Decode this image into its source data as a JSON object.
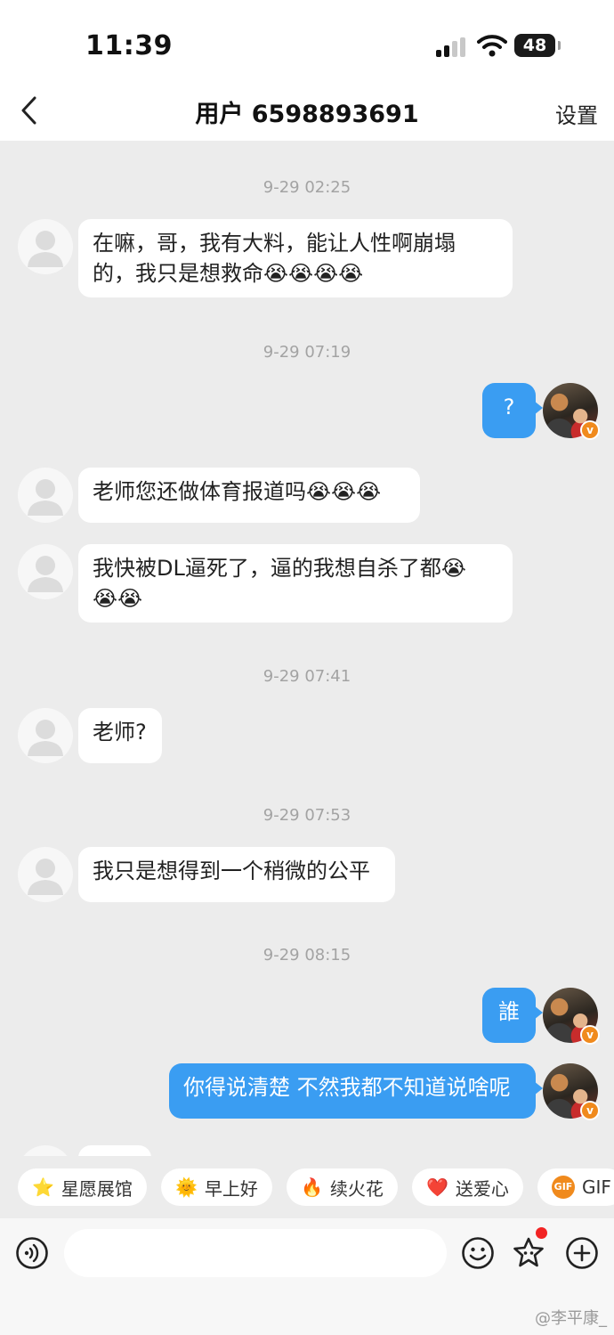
{
  "status": {
    "time": "11:39",
    "battery": "48"
  },
  "nav": {
    "title": "用户 6598893691",
    "settings": "设置"
  },
  "chat": {
    "timestamps": [
      "9-29 02:25",
      "9-29 07:19",
      "9-29 07:41",
      "9-29 07:53",
      "9-29 08:15"
    ],
    "messages": [
      {
        "side": "in",
        "line1": "在嘛，哥，我有大料，能让人性啊崩塌",
        "line2": "的，我只是想救命",
        "emoji": "😭😭😭😭"
      },
      {
        "side": "out",
        "text": "?"
      },
      {
        "side": "in",
        "text": "老师您还做体育报道吗",
        "emoji": "😭😭😭"
      },
      {
        "side": "in",
        "line1": "我快被DL逼死了，逼的我想自杀了都",
        "emoji1": "😭",
        "emoji2": "😭😭"
      },
      {
        "side": "in",
        "text": "老师?"
      },
      {
        "side": "in",
        "text": "我只是想得到一个稍微的公平"
      },
      {
        "side": "out",
        "text": "誰"
      },
      {
        "side": "out",
        "text": "你得说清楚 不然我都不知道说啥呢"
      }
    ]
  },
  "quick_replies": [
    {
      "icon": "⭐",
      "label": "星愿展馆"
    },
    {
      "icon": "🌞",
      "label": "早上好"
    },
    {
      "icon": "🔥",
      "label": "续火花"
    },
    {
      "icon": "❤️",
      "label": "送爱心"
    },
    {
      "icon": "GIF",
      "label": "GIF"
    }
  ],
  "watermark": "@李平康_",
  "colors": {
    "outgoing_bubble": "#3a9df2",
    "incoming_bubble": "#ffffff",
    "background": "#ececec",
    "verified_badge": "#f08a1d"
  }
}
